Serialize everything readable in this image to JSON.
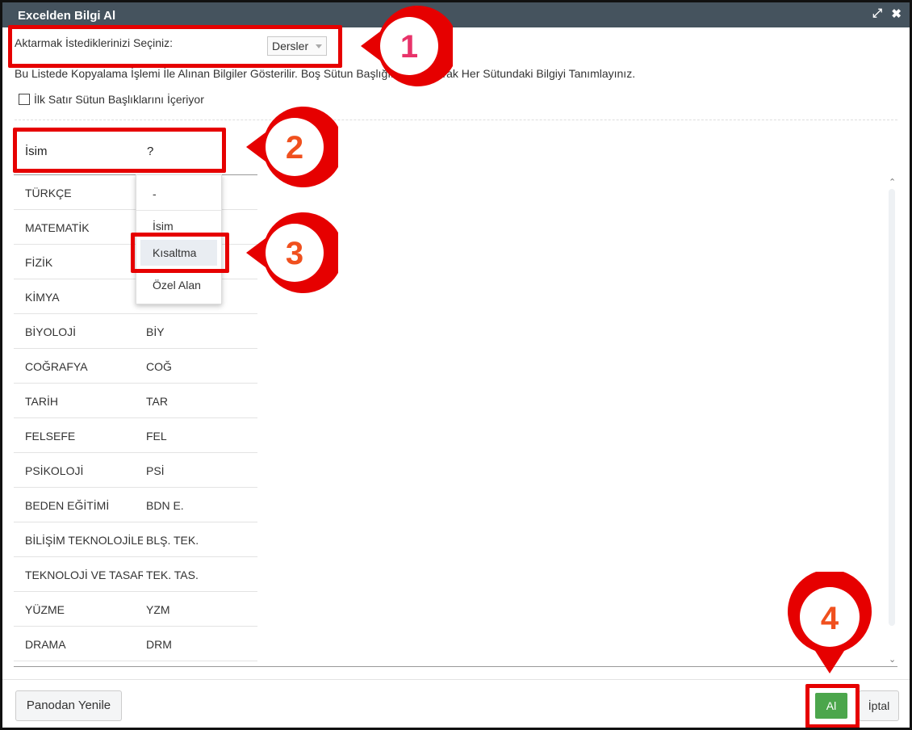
{
  "window": {
    "title": "Excelden Bilgi Al",
    "expand_icon": "⤢",
    "close_icon": "✖"
  },
  "selector": {
    "label": "Aktarmak İstediklerinizi Seçiniz:",
    "value": "Dersler"
  },
  "info_text": "Bu Listede Kopyalama İşlemi İle Alınan Bilgiler Gösterilir. Boş Sütun Başlığına Tıklayarak Her Sütundaki Bilgiyi Tanımlayınız.",
  "checkbox": {
    "label": "İlk Satır Sütun Başlıklarını İçeriyor",
    "checked": false
  },
  "table": {
    "headers": [
      "İsim",
      "?"
    ],
    "rows": [
      [
        "TÜRKÇE",
        ""
      ],
      [
        "MATEMATİK",
        ""
      ],
      [
        "FİZİK",
        ""
      ],
      [
        "KİMYA",
        ""
      ],
      [
        "BİYOLOJİ",
        "BİY"
      ],
      [
        "COĞRAFYA",
        "COĞ"
      ],
      [
        "TARİH",
        "TAR"
      ],
      [
        "FELSEFE",
        "FEL"
      ],
      [
        "PSİKOLOJİ",
        "PSİ"
      ],
      [
        "BEDEN EĞİTİMİ",
        "BDN E."
      ],
      [
        "BİLİŞİM TEKNOLOJİLERİ",
        "BLŞ. TEK."
      ],
      [
        "TEKNOLOJİ VE TASARIM",
        "TEK. TAS."
      ],
      [
        "YÜZME",
        "YZM"
      ],
      [
        "DRAMA",
        "DRM"
      ]
    ]
  },
  "dropdown": {
    "options": [
      "-",
      "İsim",
      "Kısaltma",
      "Özel Alan"
    ],
    "highlighted": "Kısaltma"
  },
  "footer": {
    "refresh_label": "Panodan Yenile",
    "submit_label": "Al",
    "cancel_label": "İptal"
  },
  "callouts": [
    "1",
    "2",
    "3",
    "4"
  ],
  "colors": {
    "titlebar": "#45535e",
    "highlight_red": "#e60000",
    "submit_green": "#4ca64c",
    "callout_number_1": "#e8336a",
    "callout_number_other": "#f0501e"
  }
}
